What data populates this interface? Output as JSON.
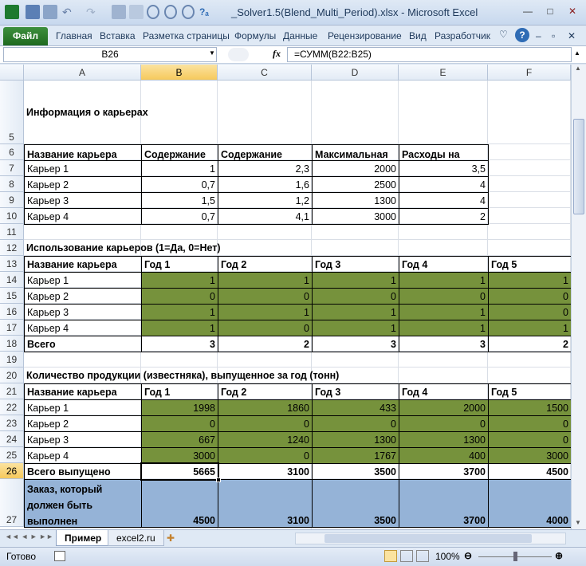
{
  "title": "_Solver1.5(Blend_Multi_Period).xlsx  -  Microsoft Excel",
  "ribbon": {
    "file": "Файл",
    "tabs": [
      "Главная",
      "Вставка",
      "Разметка страницы",
      "Формулы",
      "Данные",
      "Рецензирование",
      "Вид",
      "Разработчик"
    ]
  },
  "formula_bar": {
    "name_box": "B26",
    "fx": "fx",
    "formula": "=СУММ(B22:B25)"
  },
  "columns": [
    "A",
    "B",
    "C",
    "D",
    "E",
    "F"
  ],
  "rows": [
    "5",
    "6",
    "7",
    "8",
    "9",
    "10",
    "11",
    "12",
    "13",
    "14",
    "15",
    "16",
    "17",
    "18",
    "19",
    "20",
    "21",
    "22",
    "23",
    "24",
    "25",
    "26",
    "27"
  ],
  "section1": {
    "title": "Информация о карьерах",
    "headers": [
      "Название карьера",
      "Содержание кальция",
      "Содержание магния",
      "Максимальная производительность, тонн в год",
      "Расходы на содержание карьера в год (млн. долл.)"
    ],
    "rows": [
      [
        "Карьер 1",
        "1",
        "2,3",
        "2000",
        "3,5"
      ],
      [
        "Карьер 2",
        "0,7",
        "1,6",
        "2500",
        "4"
      ],
      [
        "Карьер 3",
        "1,5",
        "1,2",
        "1300",
        "4"
      ],
      [
        "Карьер 4",
        "0,7",
        "4,1",
        "3000",
        "2"
      ]
    ]
  },
  "section2": {
    "title": "Использование карьеров (1=Да, 0=Нет)",
    "headers": [
      "Название карьера",
      "Год 1",
      "Год 2",
      "Год 3",
      "Год 4",
      "Год 5"
    ],
    "rows": [
      [
        "Карьер 1",
        "1",
        "1",
        "1",
        "1",
        "1"
      ],
      [
        "Карьер 2",
        "0",
        "0",
        "0",
        "0",
        "0"
      ],
      [
        "Карьер 3",
        "1",
        "1",
        "1",
        "1",
        "0"
      ],
      [
        "Карьер 4",
        "1",
        "0",
        "1",
        "1",
        "1"
      ]
    ],
    "total": [
      "Всего",
      "3",
      "2",
      "3",
      "3",
      "2"
    ]
  },
  "section3": {
    "title": "Количество продукции (известняка), выпущенное за год (тонн)",
    "headers": [
      "Название карьера",
      "Год 1",
      "Год 2",
      "Год 3",
      "Год 4",
      "Год 5"
    ],
    "rows": [
      [
        "Карьер 1",
        "1998",
        "1860",
        "433",
        "2000",
        "1500"
      ],
      [
        "Карьер 2",
        "0",
        "0",
        "0",
        "0",
        "0"
      ],
      [
        "Карьер 3",
        "667",
        "1240",
        "1300",
        "1300",
        "0"
      ],
      [
        "Карьер 4",
        "3000",
        "0",
        "1767",
        "400",
        "3000"
      ]
    ],
    "total": [
      "Всего выпущено",
      "5665",
      "3100",
      "3500",
      "3700",
      "4500"
    ],
    "order": [
      "Заказ, который должен быть выполнен",
      "4500",
      "3100",
      "3500",
      "3700",
      "4000"
    ]
  },
  "sheets": {
    "active": "Пример",
    "other": "excel2.ru"
  },
  "status": {
    "ready": "Готово",
    "zoom": "100%"
  },
  "colors": {
    "green_fill": "#76923c",
    "blue_fill": "#95b3d7",
    "selected_header": "#f6c95c"
  }
}
